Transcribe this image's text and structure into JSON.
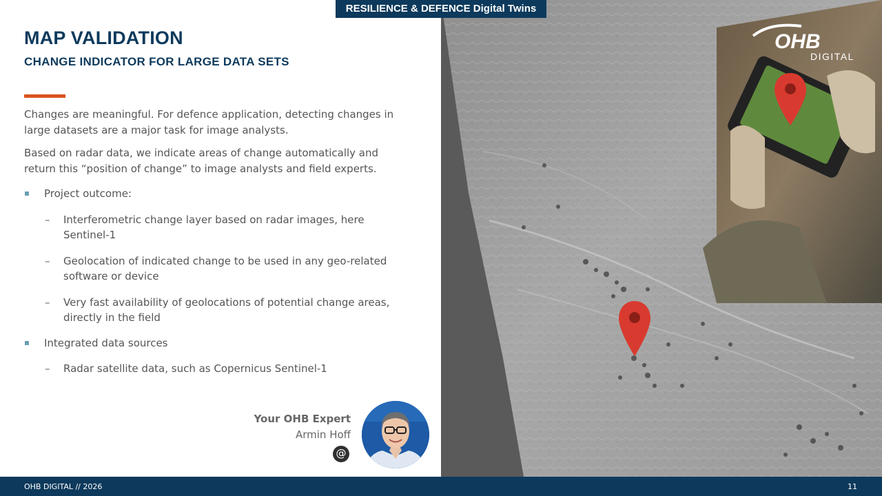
{
  "header": {
    "tag": "RESILIENCE & DEFENCE Digital Twins",
    "title": "MAP VALIDATION",
    "subtitle": "CHANGE INDICATOR FOR LARGE DATA SETS"
  },
  "logo": {
    "main": "OHB",
    "sub": "DIGITAL"
  },
  "content": {
    "paragraphs": [
      "Changes are meaningful. For defence application, detecting changes in large datasets are a major task for image analysts.",
      "Based on radar data, we indicate areas of change automatically and return this “position of change” to image analysts and field experts."
    ],
    "bullets": [
      {
        "label": "Project outcome:",
        "items": [
          "Interferometric change layer based on radar images, here Sentinel-1",
          "Geolocation of indicated change to be used in any geo-related software or device",
          "Very fast availability of geolocations of potential change areas, directly in the field"
        ]
      },
      {
        "label": "Integrated data sources",
        "items": [
          "Radar satellite data, such as Copernicus Sentinel-1"
        ]
      }
    ],
    "dash_glyph": "–"
  },
  "expert": {
    "label": "Your OHB Expert",
    "name": "Armin Hoff",
    "contact_icon": "@"
  },
  "footer": {
    "left": "OHB DIGITAL // 2026",
    "page": "11"
  },
  "colors": {
    "navy": "#0d3a5c",
    "accent": "#d9541e",
    "bullet": "#6a9fb2",
    "pin": "#d93a2f",
    "text": "#555555"
  }
}
